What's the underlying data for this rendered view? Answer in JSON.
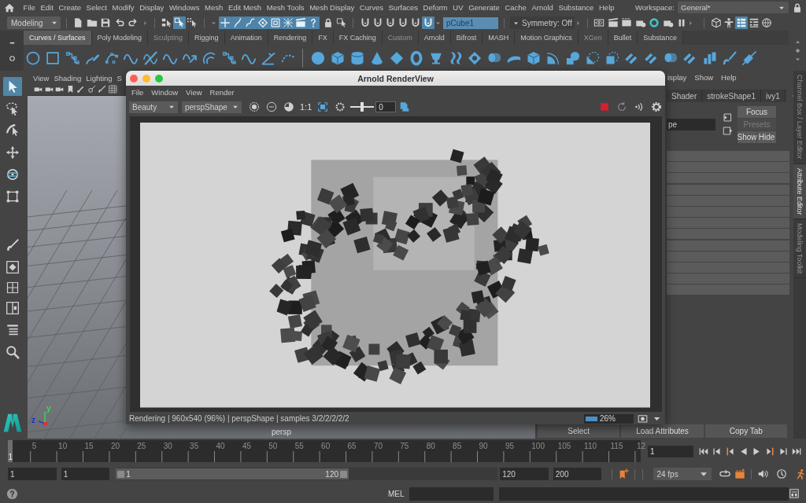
{
  "menu_bar": {
    "items": [
      "File",
      "Edit",
      "Create",
      "Select",
      "Modify",
      "Display",
      "Windows",
      "Mesh",
      "Edit Mesh",
      "Mesh Tools",
      "Mesh Display",
      "Curves",
      "Surfaces",
      "Deform",
      "UV",
      "Generate",
      "Cache",
      "Arnold",
      "Substance",
      "Help"
    ],
    "workspace_label": "Workspace:",
    "workspace": "General*"
  },
  "status_line": {
    "menu_set": "Modeling",
    "modes": [
      {
        "on": false
      },
      {
        "on": true
      },
      {
        "on": false
      }
    ],
    "masks": [
      {
        "on": true
      },
      {
        "on": true
      },
      {
        "on": true
      },
      {
        "on": true
      },
      {
        "on": true
      },
      {
        "on": true
      },
      {
        "on": true
      },
      {
        "on": true
      }
    ],
    "snaps": [
      {
        "on": false
      },
      {
        "on": false
      },
      {
        "on": false
      },
      {
        "on": false
      },
      {
        "on": false
      },
      {
        "on": true
      }
    ],
    "object_field": "pCube1",
    "symmetry": "Symmetry: Off",
    "panels": [
      {
        "on": false
      },
      {
        "on": false
      },
      {
        "on": true
      },
      {
        "on": false
      },
      {
        "on": false
      }
    ]
  },
  "shelf": {
    "tabs": [
      {
        "label": "Curves / Surfaces",
        "selected": true,
        "disabled": false
      },
      {
        "label": "Poly Modeling",
        "selected": false,
        "disabled": false
      },
      {
        "label": "Sculpting",
        "selected": false,
        "disabled": true
      },
      {
        "label": "Rigging",
        "selected": false,
        "disabled": false
      },
      {
        "label": "Animation",
        "selected": false,
        "disabled": false
      },
      {
        "label": "Rendering",
        "selected": false,
        "disabled": false
      },
      {
        "label": "FX",
        "selected": false,
        "disabled": false
      },
      {
        "label": "FX Caching",
        "selected": false,
        "disabled": false
      },
      {
        "label": "Custom",
        "selected": false,
        "disabled": true
      },
      {
        "label": "Arnold",
        "selected": false,
        "disabled": false
      },
      {
        "label": "Bifrost",
        "selected": false,
        "disabled": false
      },
      {
        "label": "MASH",
        "selected": false,
        "disabled": false
      },
      {
        "label": "Motion Graphics",
        "selected": false,
        "disabled": false
      },
      {
        "label": "XGen",
        "selected": false,
        "disabled": true
      },
      {
        "label": "Bullet",
        "selected": false,
        "disabled": false
      },
      {
        "label": "Substance",
        "selected": false,
        "disabled": false
      }
    ]
  },
  "toolbox": [
    {
      "kind": "select",
      "selected": true
    },
    {
      "kind": "lasso",
      "selected": false
    },
    {
      "kind": "paint",
      "selected": false
    },
    {
      "kind": "move",
      "selected": false
    },
    {
      "kind": "rotate",
      "selected": false
    },
    {
      "kind": "scale",
      "selected": false
    }
  ],
  "viewport": {
    "menus": [
      "View",
      "Shading",
      "Lighting",
      "S"
    ],
    "axis_labels": [
      "y",
      "z"
    ],
    "camera": "persp"
  },
  "render_view": {
    "title": "Arnold RenderView",
    "menus": [
      "File",
      "Window",
      "View",
      "Render"
    ],
    "aov": "Beauty",
    "camera": "perspShape",
    "ratio": "1:1",
    "exposure": {
      "level": 0.5,
      "value": "0"
    },
    "status": "Rendering | 960x540 (96%) | perspShape | samples 3/2/2/2/2/2",
    "progress": {
      "level": 0.26,
      "reading": "26%"
    }
  },
  "attribute_editor": {
    "menus": [
      "isplay",
      "Show",
      "Help"
    ],
    "tabs": [
      "Shader",
      "strokeShape1",
      "ivy1"
    ],
    "name_field": "pe",
    "buttons": [
      {
        "label": "Focus",
        "disabled": false
      },
      {
        "label": "Presets",
        "disabled": true
      },
      {
        "label": "Show",
        "disabled": false
      },
      {
        "label": "Hide",
        "disabled": false
      }
    ],
    "bottom_buttons": [
      "Select",
      "Load Attributes",
      "Copy Tab"
    ]
  },
  "side_tabs": [
    {
      "label": "Channel Box / Layer Editor",
      "selected": false
    },
    {
      "label": "Attribute Editor",
      "selected": true
    },
    {
      "label": "Modeling Toolkit",
      "selected": false
    }
  ],
  "time_slider": {
    "ticks": [
      "5",
      "10",
      "15",
      "20",
      "25",
      "30",
      "35",
      "40",
      "45",
      "50",
      "55",
      "60",
      "65",
      "70",
      "75",
      "80",
      "85",
      "90",
      "95",
      "100",
      "105",
      "110",
      "115",
      "12"
    ],
    "level": 0,
    "current_frame": "1",
    "frame_field": "1"
  },
  "range_slider": {
    "start_fields": [
      "1",
      "1"
    ],
    "range_bar": {
      "level": 0.61,
      "start": "1",
      "end": "120"
    },
    "end_fields": [
      "120",
      "200"
    ],
    "fps": "24 fps"
  },
  "command_line": {
    "language": "MEL"
  }
}
